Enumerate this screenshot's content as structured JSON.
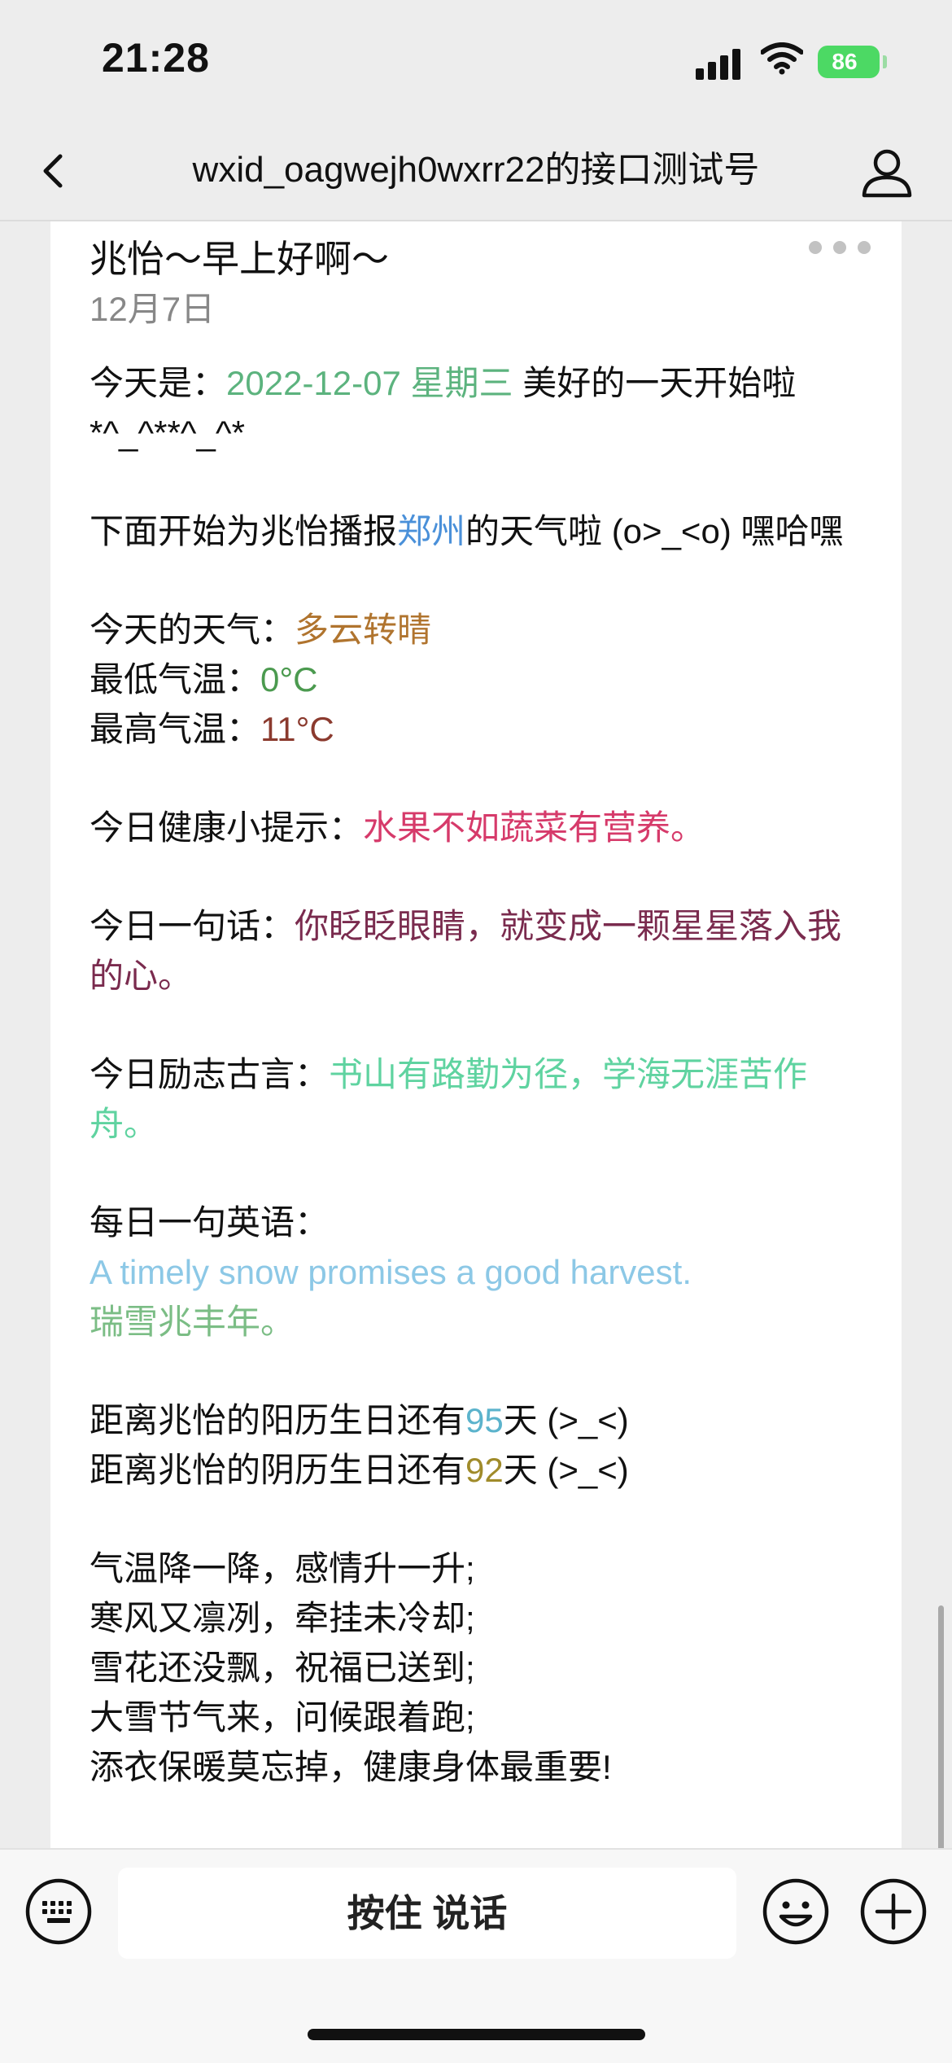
{
  "status_bar": {
    "time": "21:28",
    "battery": "86"
  },
  "nav": {
    "title": "wxid_oagwejh0wxrr22的接口测试号",
    "back_icon": "chevron-left-icon",
    "profile_icon": "user-icon"
  },
  "message": {
    "title": "兆怡～早上好啊～",
    "date": "12月7日",
    "today_prefix": "今天是：",
    "today_value": "2022-12-07 星期三",
    "today_suffix": " 美好的一天开始啦*^_^**^_^*",
    "report_prefix": "下面开始为兆怡播报",
    "city": "郑州",
    "report_suffix": "的天气啦 (o>_<o) 嘿哈嘿",
    "weather_label": "今天的天气：",
    "weather_value": "多云转晴",
    "min_temp_label": "最低气温：",
    "min_temp_value": "0°C",
    "max_temp_label": "最高气温：",
    "max_temp_value": "11°C",
    "health_label": "今日健康小提示：",
    "health_value": "水果不如蔬菜有营养。",
    "sentence_label": "今日一句话：",
    "sentence_value": "你眨眨眼睛，就变成一颗星星落入我的心。",
    "motto_label": "今日励志古言：",
    "motto_value": "书山有路勤为径，学海无涯苦作舟。",
    "english_label": "每日一句英语：",
    "english_value": "A timely snow promises a good harvest.",
    "english_translation": "瑞雪兆丰年。",
    "solar_prefix": "距离兆怡的阳历生日还有",
    "solar_days": "95",
    "solar_suffix": "天 (>_<)",
    "lunar_prefix": "距离兆怡的阴历生日还有",
    "lunar_days": "92",
    "lunar_suffix": "天 (>_<)",
    "poem": [
      "气温降一降，感情升一升;",
      "寒风又凛冽，牵挂未冷却;",
      "雪花还没飘，祝福已送到;",
      "大雪节气来，问候跟着跑;",
      "添衣保暖莫忘掉，健康身体最重要!"
    ]
  },
  "input_bar": {
    "talk_label": "按住 说话",
    "keyboard_icon": "keyboard-icon",
    "emoji_icon": "emoji-icon",
    "plus_icon": "plus-icon"
  },
  "colors": {
    "date_green": "#5cb37e",
    "city_blue": "#4a90d9",
    "weather_brown": "#b0742e",
    "min_green": "#4b9a4f",
    "max_red": "#8b3a2e",
    "health_pink": "#d63a6a",
    "sentence_purple": "#7a2b4e",
    "motto_mint": "#5fd3a0",
    "english_blue": "#8cc8e6",
    "translation_green": "#7bbd85",
    "solar_blue": "#5bb3cc",
    "lunar_olive": "#a08b2a"
  }
}
